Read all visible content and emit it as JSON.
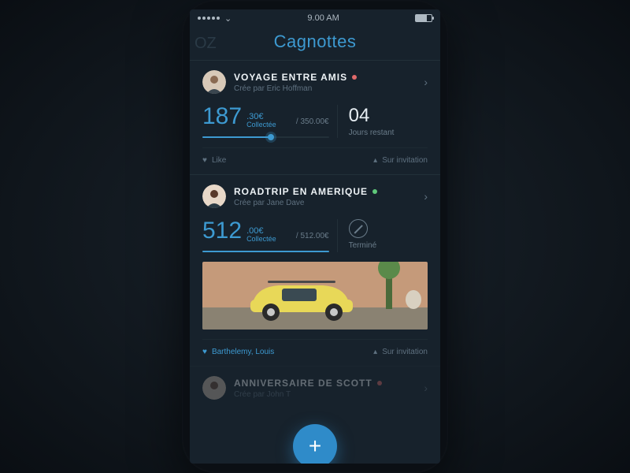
{
  "statusbar": {
    "time": "9.00 AM"
  },
  "navbar": {
    "title": "Cagnottes",
    "ghost": "OZ"
  },
  "cards": [
    {
      "title": "VOYAGE ENTRE AMIS",
      "creator": "Crée par Eric Hoffman",
      "status_color": "red",
      "amount_int": "187",
      "amount_dec": ".30€",
      "amount_sub": "Collectée",
      "goal": "/ 350.00€",
      "progress_pct": 54,
      "days_n": "04",
      "days_l": "Jours restant",
      "like_label": "Like",
      "invite_label": "Sur invitation"
    },
    {
      "title": "ROADTRIP EN AMERIQUE",
      "creator": "Crée par Jane Dave",
      "status_color": "green",
      "amount_int": "512",
      "amount_dec": ".00€",
      "amount_sub": "Collectée",
      "goal": "/ 512.00€",
      "progress_pct": 100,
      "done_label": "Terminé",
      "like_label": "Barthelemy, Louis",
      "invite_label": "Sur invitation"
    },
    {
      "title": "ANNIVERSAIRE DE SCOTT",
      "creator": "Crée par John T",
      "status_color": "red"
    }
  ],
  "fab": {
    "glyph": "+"
  }
}
